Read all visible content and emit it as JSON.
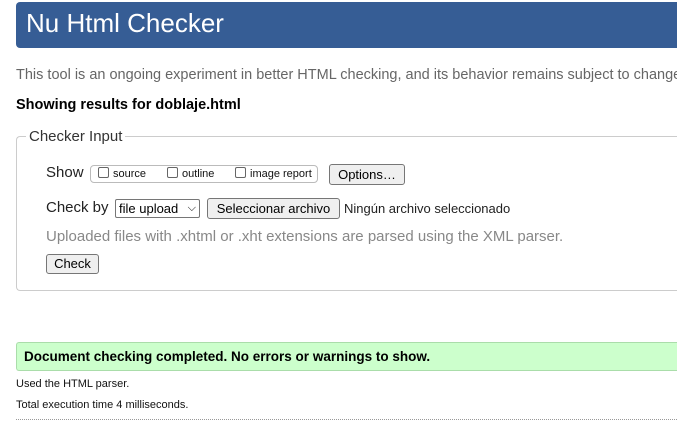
{
  "header": {
    "title": "Nu Html Checker"
  },
  "intro": {
    "text": "This tool is an ongoing experiment in better HTML checking, and its behavior remains subject to change"
  },
  "results": {
    "title": "Showing results for doblaje.html"
  },
  "checker_input": {
    "legend": "Checker Input",
    "show_label": "Show",
    "options": [
      {
        "label": "source",
        "checked": false
      },
      {
        "label": "outline",
        "checked": false
      },
      {
        "label": "image report",
        "checked": false
      }
    ],
    "options_button": "Options…",
    "check_by_label": "Check by",
    "check_by_value": "file upload",
    "choose_file_button": "Seleccionar archivo",
    "file_status": "Ningún archivo seleccionado",
    "hint": "Uploaded files with .xhtml or .xht extensions are parsed using the XML parser.",
    "check_button": "Check"
  },
  "status": {
    "message": "Document checking completed. No errors or warnings to show.",
    "parser": "Used the HTML parser.",
    "execution_time": "Total execution time 4 milliseconds."
  },
  "colors": {
    "header_bg": "#365d95",
    "success_bg": "#ccffcc"
  }
}
